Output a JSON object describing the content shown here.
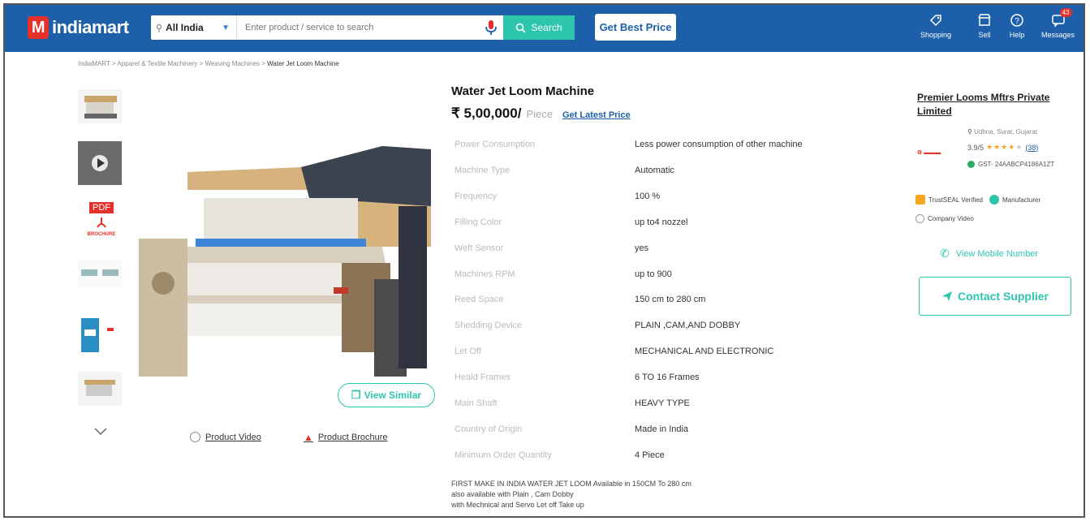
{
  "header": {
    "logo_text": "indiamart",
    "logo_letter": "M",
    "location": "All India",
    "search_placeholder": "Enter product / service to search",
    "search_label": "Search",
    "best_price_label": "Get Best Price",
    "nav": [
      {
        "label": "Shopping",
        "icon": "shopping-icon"
      },
      {
        "label": "Sell",
        "icon": "sell-icon"
      },
      {
        "label": "Help",
        "icon": "help-icon"
      },
      {
        "label": "Messages",
        "icon": "messages-icon",
        "badge": "43"
      }
    ]
  },
  "breadcrumb": {
    "items": [
      "IndiaMART",
      "Apparel & Textile Machinery",
      "Weaving Machines"
    ],
    "separator": ">",
    "current": "Water Jet Loom Machine"
  },
  "gallery": {
    "pdf_tag": "PDF",
    "pdf_caption": "BROCHURE",
    "view_similar": "View Similar",
    "product_video": "Product Video",
    "product_brochure": "Product Brochure"
  },
  "product": {
    "title": "Water Jet Loom Machine",
    "price": "₹ 5,00,000/",
    "price_unit": "Piece",
    "latest_price_label": "Get Latest Price",
    "specs": [
      {
        "key": "Power Consumption",
        "value": "Less power consumption of other machine"
      },
      {
        "key": "Machine Type",
        "value": "Automatic"
      },
      {
        "key": "Frequency",
        "value": "100 %"
      },
      {
        "key": "Filling Color",
        "value": "up to4 nozzel"
      },
      {
        "key": "Weft Sensor",
        "value": "yes"
      },
      {
        "key": "Machines RPM",
        "value": "up to 900"
      },
      {
        "key": "Reed Space",
        "value": "150 cm to 280 cm"
      },
      {
        "key": "Shedding Device",
        "value": "PLAIN ,CAM,AND DOBBY"
      },
      {
        "key": "Let Off",
        "value": "MECHANICAL AND ELECTRONIC"
      },
      {
        "key": "Heald Frames",
        "value": "6 TO 16 Frames"
      },
      {
        "key": "Main Shaft",
        "value": "HEAVY TYPE"
      },
      {
        "key": "Country of Origin",
        "value": "Made in India"
      },
      {
        "key": "Minimum Order Quantity",
        "value": "4 Piece"
      }
    ],
    "description": [
      "FIRST MAKE IN INDIA WATER JET LOOM Available in 150CM To 280 cm",
      "also available with Plain , Cam Dobby",
      "with  Mechnical and Servo Let off Take up"
    ]
  },
  "supplier": {
    "name": "Premier Looms Mftrs Private Limited",
    "location": "Udhna, Surat, Gujarat",
    "rating": "3.9",
    "rating_max": "/5",
    "rating_stars": 3.9,
    "review_count": "(38)",
    "gst": "GST- 24AABCP4186A1ZT",
    "trustseal": "TrustSEAL Verified",
    "manufacturer": "Manufacturer",
    "company_video": "Company Video",
    "view_mobile": "View Mobile Number",
    "contact_label": "Contact Supplier"
  },
  "colors": {
    "header_blue": "#1d5fa8",
    "accent_teal": "#2ec5ad",
    "brand_red": "#e4322b"
  }
}
